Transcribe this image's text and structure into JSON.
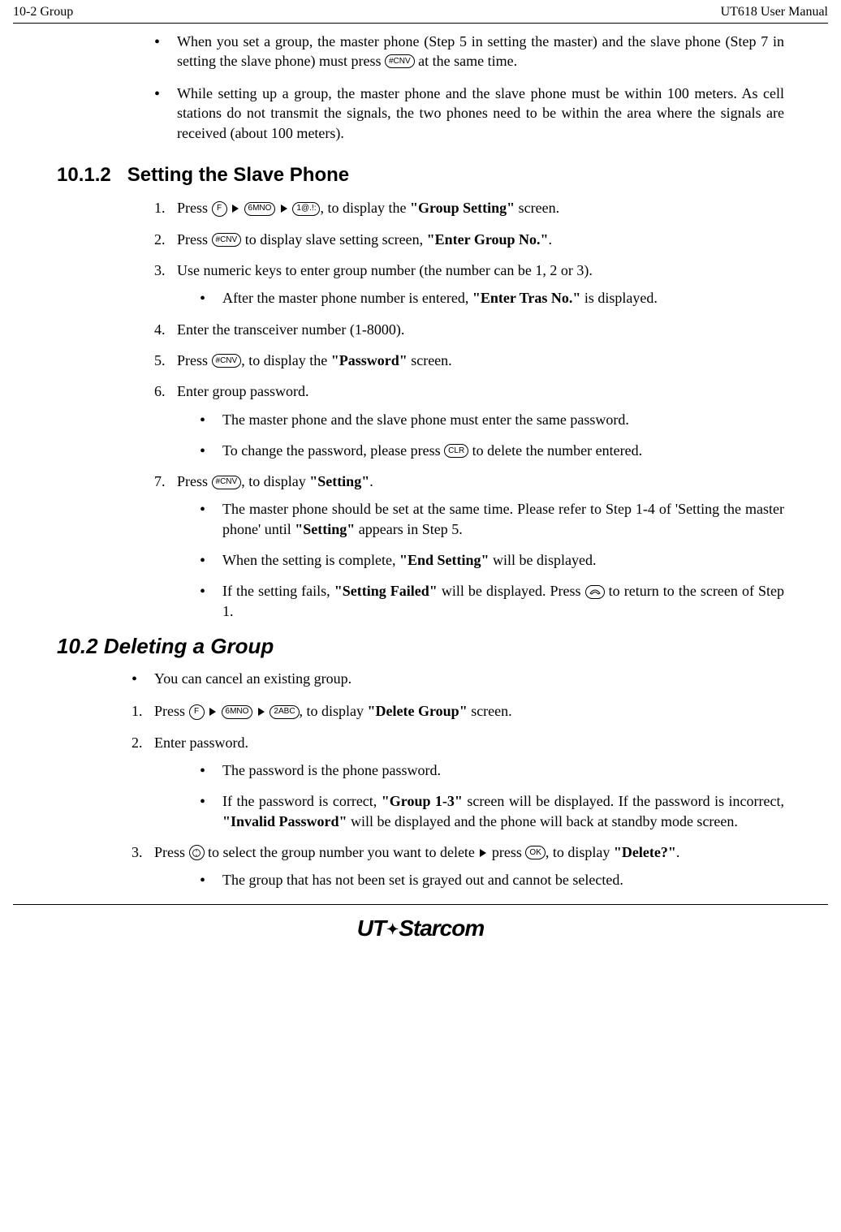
{
  "header": {
    "left": "10-2   Group",
    "right": "UT618 User Manual"
  },
  "intro_bullets": [
    {
      "pre": "When you set a group, the master phone (Step 5 in setting the master) and the slave phone (Step 7 in setting the slave phone) must press ",
      "key": "hash",
      "post": " at the same time."
    },
    {
      "text": "While setting up a group, the master phone and the slave phone must be within 100 meters. As cell stations do not transmit the signals, the two phones need to be within the area where the signals are received (about 100 meters)."
    }
  ],
  "sec_10_1_2": {
    "number": "10.1.2",
    "title": "Setting the Slave Phone",
    "steps": {
      "s1_a": "Press ",
      "s1_b": ", to display the ",
      "s1_bold": "\"Group Setting\"",
      "s1_c": " screen.",
      "s2_a": "Press ",
      "s2_b": " to display slave setting screen, ",
      "s2_bold": "\"Enter Group No.\"",
      "s2_c": ".",
      "s3": "Use numeric keys to enter group number (the number can be 1, 2 or 3).",
      "s3_sub_a": "After the master phone number is entered, ",
      "s3_sub_bold": "\"Enter Tras No.\"",
      "s3_sub_b": " is displayed.",
      "s4": "Enter the transceiver number (1-8000).",
      "s5_a": "Press ",
      "s5_b": ", to display the ",
      "s5_bold": "\"Password\"",
      "s5_c": " screen.",
      "s6": "Enter group password.",
      "s6_sub1": "The master phone and the slave phone must enter the same password.",
      "s6_sub2_a": "To change the password, please press ",
      "s6_sub2_b": " to delete the number entered.",
      "s7_a": "Press ",
      "s7_b": ", to display ",
      "s7_bold": "\"Setting\"",
      "s7_c": ".",
      "s7_sub1_a": "The master phone should be set at the same time. Please refer to Step 1-4 of 'Setting the master phone' until ",
      "s7_sub1_bold": "\"Setting\"",
      "s7_sub1_b": " appears in Step 5.",
      "s7_sub2_a": "When the setting is complete, ",
      "s7_sub2_bold": "\"End Setting\"",
      "s7_sub2_b": " will be displayed.",
      "s7_sub3_a": "If the setting fails, ",
      "s7_sub3_bold": "\"Setting Failed\"",
      "s7_sub3_b": " will be displayed. Press ",
      "s7_sub3_c": " to return to the screen of Step 1."
    }
  },
  "sec_10_2": {
    "title": "10.2 Deleting a Group",
    "intro_bullet": "You can cancel an existing group.",
    "steps": {
      "s1_a": "Press ",
      "s1_b": ",  to display ",
      "s1_bold": "\"Delete Group\"",
      "s1_c": " screen.",
      "s2": "Enter password.",
      "s2_sub1": "The password is the phone password.",
      "s2_sub2_a": "If the password is correct, ",
      "s2_sub2_bold1": "\"Group 1-3\"",
      "s2_sub2_b": " screen will be displayed. If the password is incorrect, ",
      "s2_sub2_bold2": "\"Invalid Password\"",
      "s2_sub2_c": " will be displayed and the phone will back at standby mode screen.",
      "s3_a": "Press ",
      "s3_b": " to select the group number you want to delete ",
      "s3_c": " press ",
      "s3_d": ", to display ",
      "s3_bold": "\"Delete?\"",
      "s3_e": ".",
      "s3_sub1": "The group that has not been set is grayed out and cannot be selected."
    }
  },
  "keys": {
    "F": "F",
    "six": "6MNO",
    "one": "1@.!:",
    "two": "2ABC",
    "hash": "#CNV",
    "clr": "CLR",
    "ok": "OK"
  },
  "footer_logo": {
    "ut": "UT",
    "rest": "Starcom"
  }
}
